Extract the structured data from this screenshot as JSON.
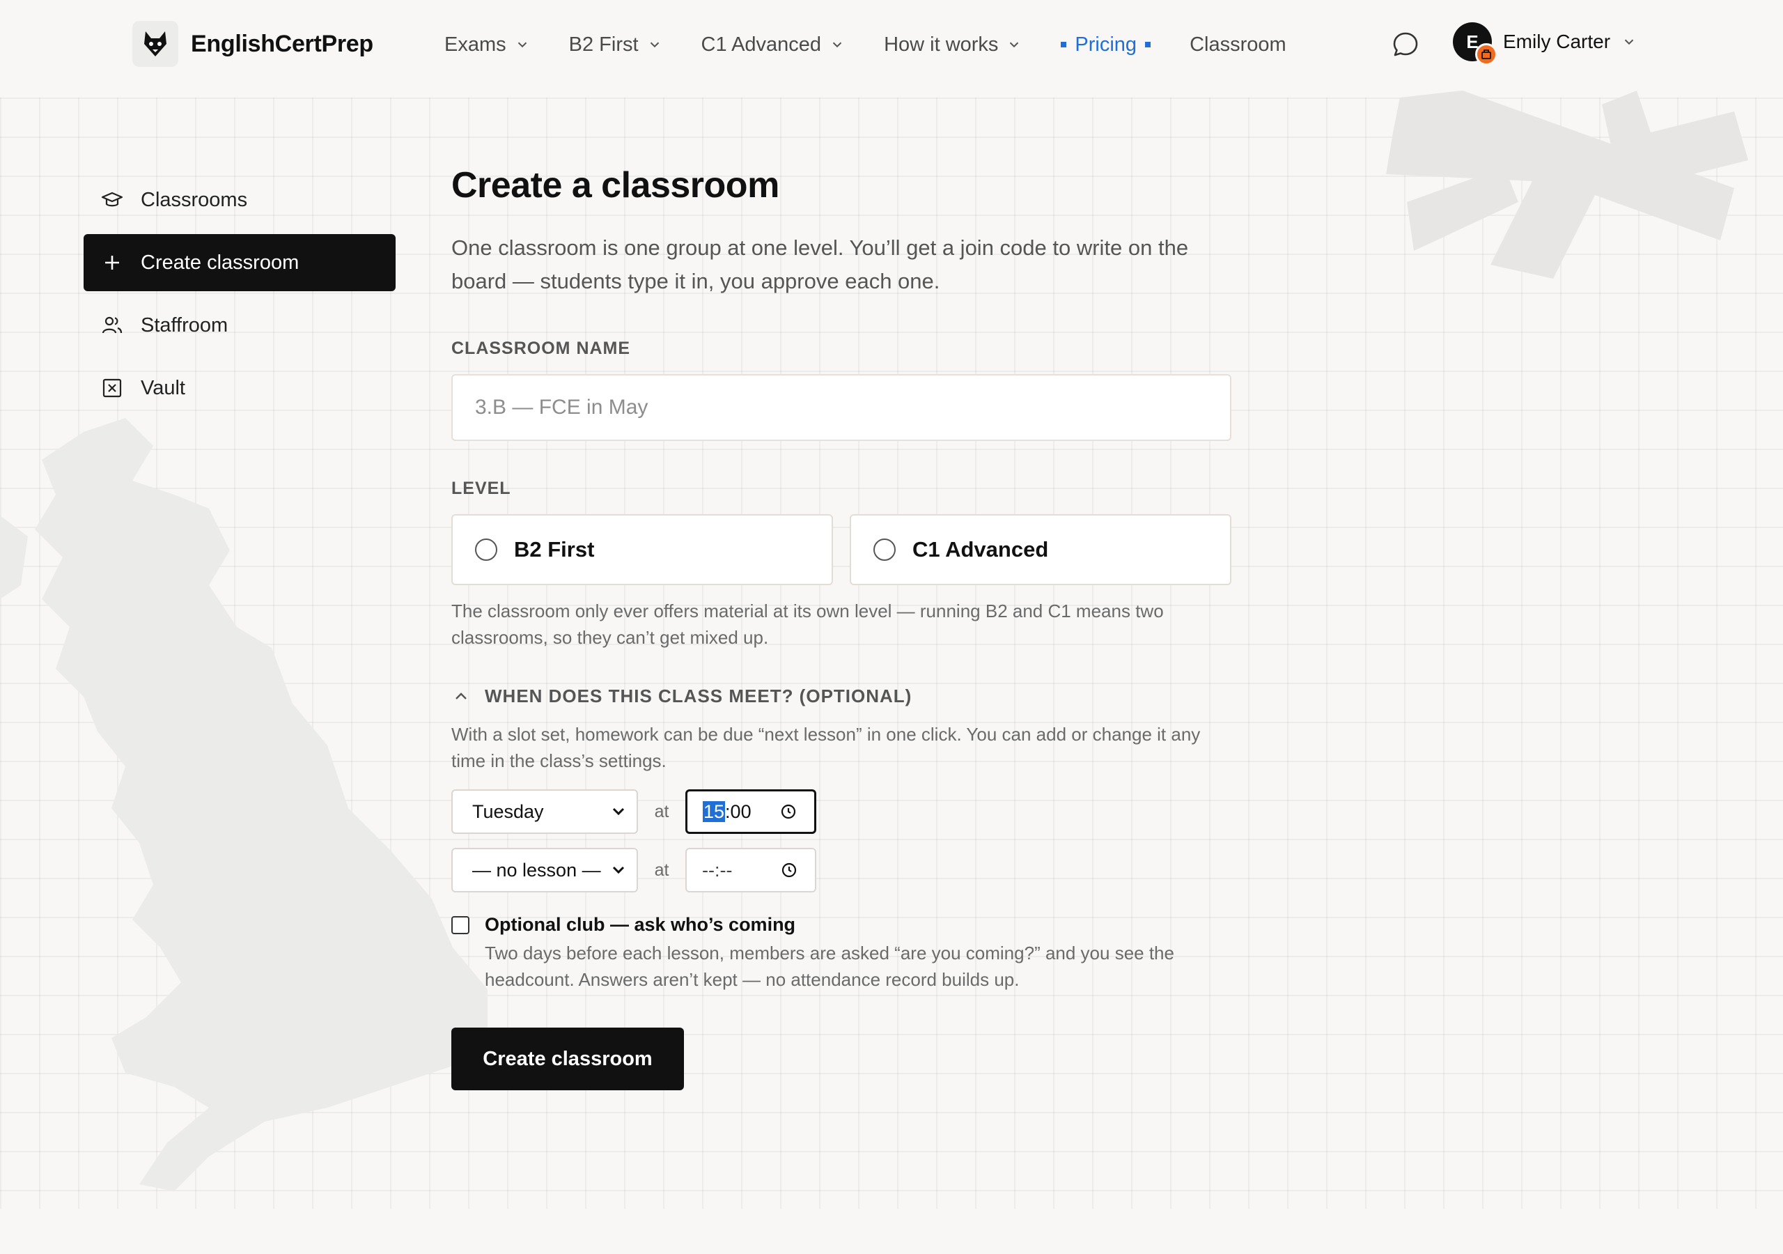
{
  "brand": {
    "name": "EnglishCertPrep",
    "logo_icon": "fox-icon"
  },
  "nav": {
    "items": [
      {
        "label": "Exams",
        "has_menu": true
      },
      {
        "label": "B2 First",
        "has_menu": true
      },
      {
        "label": "C1 Advanced",
        "has_menu": true
      },
      {
        "label": "How it works",
        "has_menu": true
      },
      {
        "label": "Pricing",
        "active": true
      },
      {
        "label": "Classroom"
      }
    ],
    "accent_color": "#1f6fd6"
  },
  "user": {
    "initial": "E",
    "name": "Emily Carter",
    "badge_color": "#f26b1d"
  },
  "sidebar": {
    "items": [
      {
        "label": "Classrooms",
        "icon": "graduation-cap-icon"
      },
      {
        "label": "Create classroom",
        "icon": "plus-icon",
        "active": true
      },
      {
        "label": "Staffroom",
        "icon": "users-icon"
      },
      {
        "label": "Vault",
        "icon": "vault-x-icon"
      }
    ]
  },
  "form": {
    "title": "Create a classroom",
    "description": "One classroom is one group at one level. You’ll get a join code to write on the board — students type it in, you approve each one.",
    "name_label": "CLASSROOM NAME",
    "name_placeholder": "3.B — FCE in May",
    "name_value": "",
    "level_label": "LEVEL",
    "levels": [
      {
        "label": "B2 First",
        "selected": false
      },
      {
        "label": "C1 Advanced",
        "selected": false
      }
    ],
    "level_help": "The classroom only ever offers material at its own level — running B2 and C1 means two classrooms, so they can’t get mixed up.",
    "meet_label": "WHEN DOES THIS CLASS MEET? (OPTIONAL)",
    "meet_help": "With a slot set, homework can be due “next lesson” in one click. You can add or change it any time in the class’s settings.",
    "slots": [
      {
        "day": "Tuesday",
        "at": "at",
        "time_hour": "15",
        "time_rest": ":00"
      },
      {
        "day": "— no lesson —",
        "at": "at",
        "time_hour": "",
        "time_rest": "--:--"
      }
    ],
    "optional_club": {
      "title": "Optional club — ask who’s coming",
      "description": "Two days before each lesson, members are asked “are you coming?” and you see the headcount. Answers aren’t kept — no attendance record builds up.",
      "checked": false
    },
    "submit_label": "Create classroom"
  }
}
